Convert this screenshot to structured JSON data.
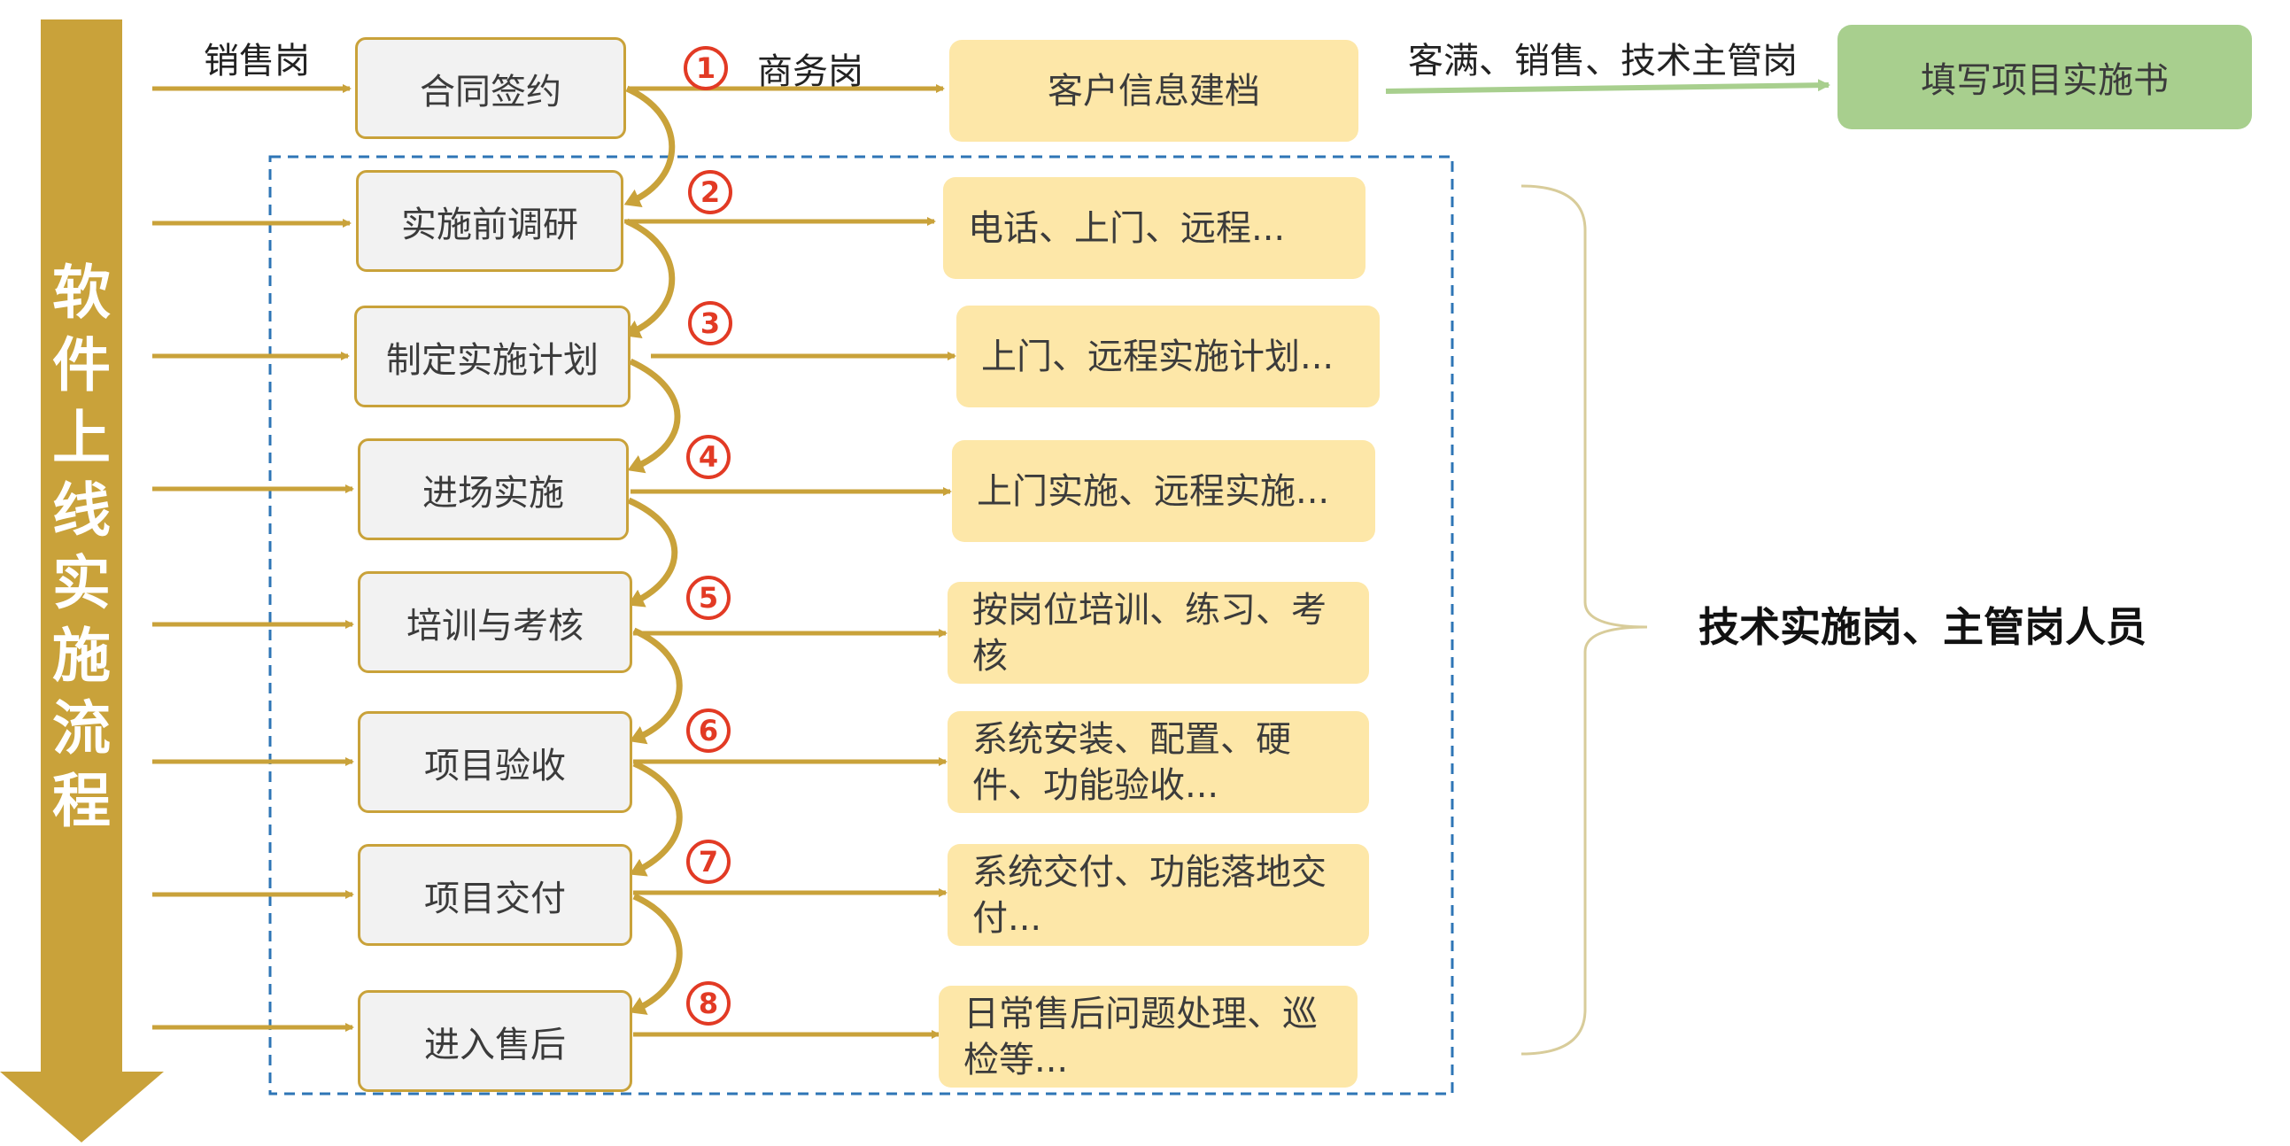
{
  "title": "软件上线实施流程",
  "top_flow": {
    "sales_label": "销售岗",
    "business_label": "商务岗",
    "supervisor_label": "客满、销售、技术主管岗",
    "customer_archive": "客户信息建档",
    "implementation_doc": "填写项目实施书"
  },
  "steps": [
    {
      "num": "1",
      "name": "合同签约"
    },
    {
      "num": "2",
      "name": "实施前调研",
      "detail": "电话、上门、远程..."
    },
    {
      "num": "3",
      "name": "制定实施计划",
      "detail": "上门、远程实施计划..."
    },
    {
      "num": "4",
      "name": "进场实施",
      "detail": "上门实施、远程实施..."
    },
    {
      "num": "5",
      "name": "培训与考核",
      "detail": "按岗位培训、练习、考核"
    },
    {
      "num": "6",
      "name": "项目验收",
      "detail": "系统安装、配置、硬件、功能验收..."
    },
    {
      "num": "7",
      "name": "项目交付",
      "detail": "系统交付、功能落地交付..."
    },
    {
      "num": "8",
      "name": "进入售后",
      "detail": "日常售后问题处理、巡检等..."
    }
  ],
  "responsible_roles": "技术实施岗、主管岗人员",
  "colors": {
    "gold": "#c9a23a",
    "detail_fill": "#fde7a8",
    "step_fill": "#f2f2f2",
    "number_red": "#e23a24",
    "green_fill": "#a8cf8e",
    "green_arrow": "#a8cf8e",
    "dashed_border": "#2e75b6"
  }
}
